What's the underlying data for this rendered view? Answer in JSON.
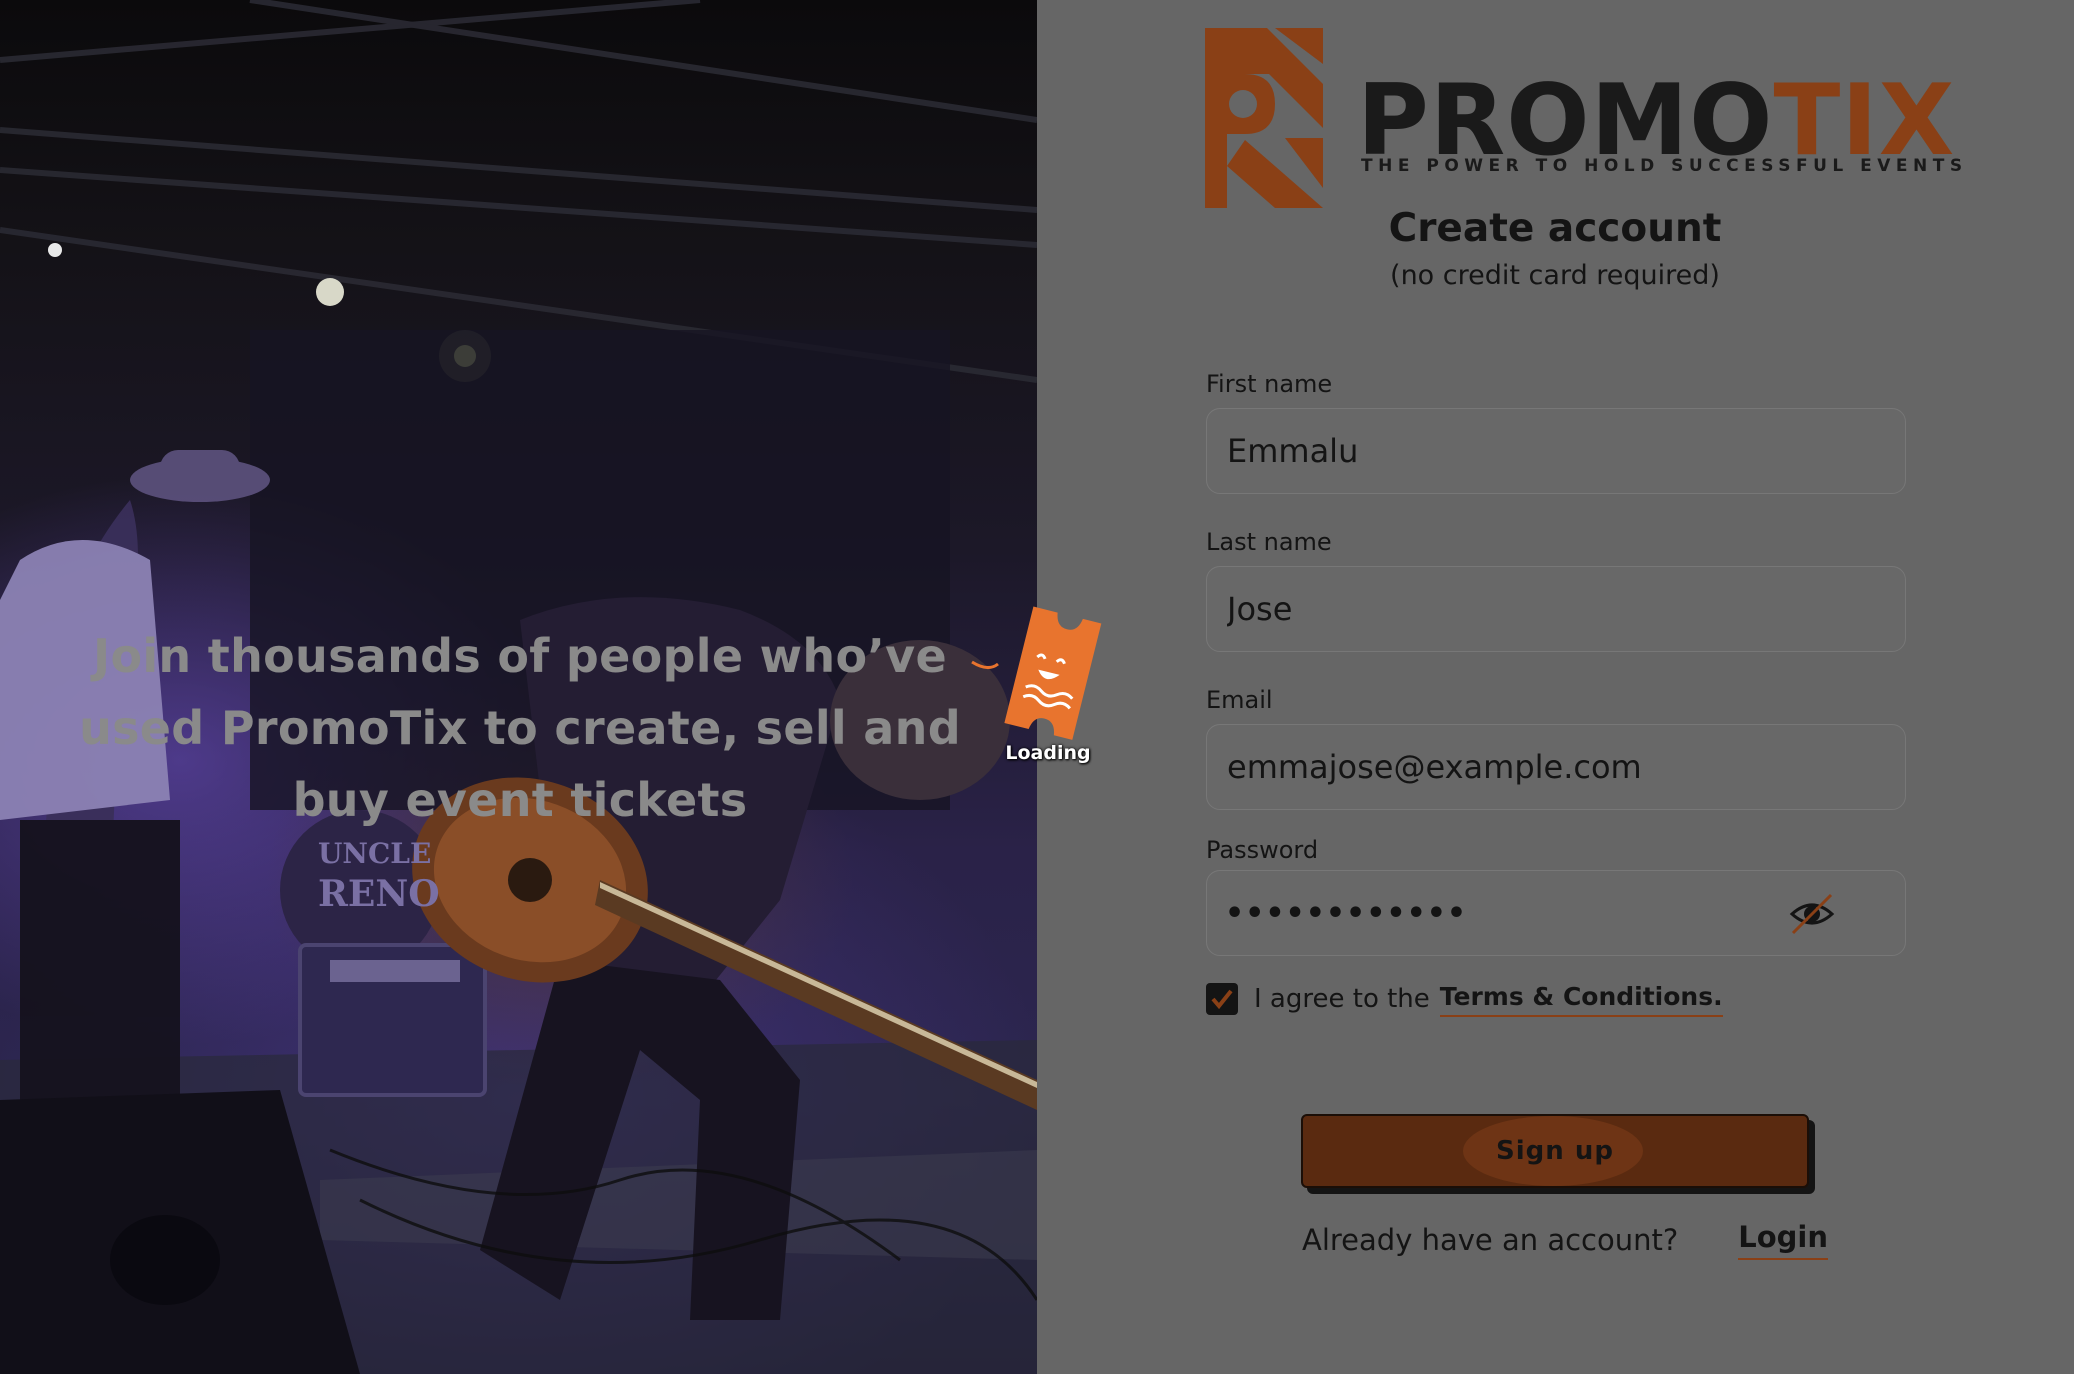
{
  "hero": {
    "tagline": "Join thousands of people who’ve used PromoTix to create, sell and buy event tickets",
    "drum_text_line1": "UNCLE",
    "drum_text_line2": "RENO"
  },
  "logo": {
    "name_part1": "PROMO",
    "name_part2": "TIX",
    "tagline": "THE POWER TO HOLD SUCCESSFUL EVENTS"
  },
  "form": {
    "title": "Create account",
    "subtitle": "(no credit card required)",
    "first_name": {
      "label": "First name",
      "value": "Emmalu"
    },
    "last_name": {
      "label": "Last name",
      "value": "Jose"
    },
    "email": {
      "label": "Email",
      "value": "emmajose@example.com"
    },
    "password": {
      "label": "Password",
      "masked_value": "••••••••••••",
      "visibility_icon": "eye-slash-icon"
    },
    "agree": {
      "checked": true,
      "text": "I agree to the",
      "link": "Terms & Conditions."
    },
    "submit_label": "Sign up",
    "login_prompt": "Already have an account?",
    "login_link": "Login"
  },
  "loader": {
    "label": "Loading",
    "icon": "ticket-icon"
  },
  "colors": {
    "accent": "#8a4016",
    "overlay_panel": "#666666",
    "loader_orange": "#e8742e",
    "text_dark": "#141414"
  }
}
